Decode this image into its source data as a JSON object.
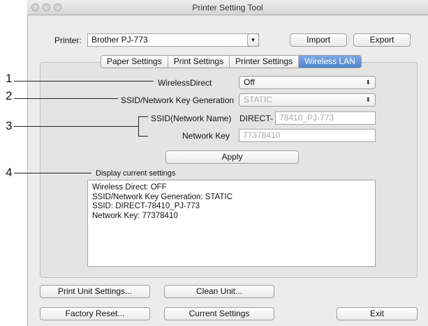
{
  "window": {
    "title": "Printer Setting Tool"
  },
  "printer": {
    "label": "Printer:",
    "value": "Brother PJ-773"
  },
  "toolbar": {
    "import_label": "Import",
    "export_label": "Export"
  },
  "tabs": [
    {
      "label": "Paper Settings"
    },
    {
      "label": "Print Settings"
    },
    {
      "label": "Printer Settings"
    },
    {
      "label": "Wireless LAN"
    }
  ],
  "wireless": {
    "wireless_direct_label": "WirelessDirect",
    "wireless_direct_value": "Off",
    "ssid_gen_label": "SSID/Network Key Generation",
    "ssid_gen_value": "STATIC",
    "ssid_label": "SSID(Network Name)",
    "ssid_prefix": "DIRECT-",
    "ssid_value": "78410_PJ-773",
    "network_key_label": "Network Key",
    "network_key_value": "77378410",
    "apply_label": "Apply"
  },
  "current_settings": {
    "label": "Display current settings",
    "lines": [
      "Wireless Direct: OFF",
      "SSID/Network Key Generation: STATIC",
      "SSID: DIRECT-78410_PJ-773",
      "Network Key: 77378410"
    ]
  },
  "bottom_buttons": {
    "print_unit_settings": "Print Unit Settings...",
    "clean_unit": "Clean Unit...",
    "factory_reset": "Factory Reset...",
    "current_settings": "Current Settings",
    "exit": "Exit"
  },
  "callouts": [
    "1",
    "2",
    "3",
    "4"
  ],
  "icons": {
    "select_arrow": "up-down-arrows-icon",
    "dropdown": "chevron-down-icon"
  }
}
